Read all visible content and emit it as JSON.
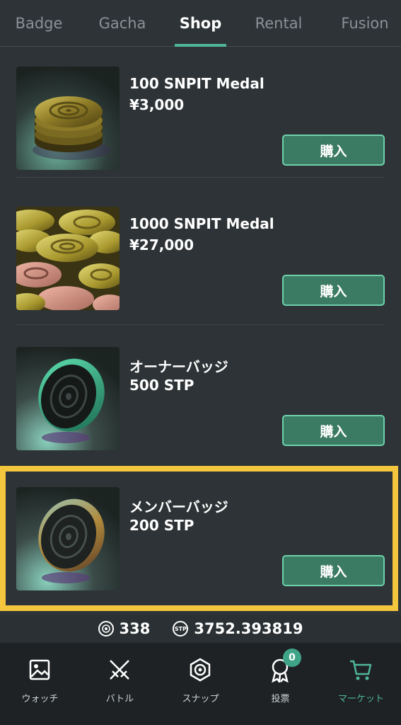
{
  "tabs": [
    {
      "label": "Badge",
      "active": false
    },
    {
      "label": "Gacha",
      "active": false
    },
    {
      "label": "Shop",
      "active": true
    },
    {
      "label": "Rental",
      "active": false
    },
    {
      "label": "Fusion",
      "active": false
    }
  ],
  "items": [
    {
      "name": "100 SNPIT Medal",
      "price": "¥3,000",
      "buy_label": "購入",
      "image": "medal-stack-image"
    },
    {
      "name": "1000 SNPIT Medal",
      "price": "¥27,000",
      "buy_label": "購入",
      "image": "medal-pile-image"
    },
    {
      "name": "オーナーバッジ",
      "price": "500 STP",
      "buy_label": "購入",
      "image": "owner-badge-image"
    },
    {
      "name": "メンバーバッジ",
      "price": "200 STP",
      "buy_label": "購入",
      "image": "member-badge-image",
      "highlighted": true
    }
  ],
  "balance": {
    "medal_count": "338",
    "stp_icon_label": "STP",
    "stp_amount": "3752.393819"
  },
  "nav": [
    {
      "label": "ウォッチ",
      "icon": "image-icon"
    },
    {
      "label": "バトル",
      "icon": "swords-icon"
    },
    {
      "label": "スナップ",
      "icon": "camera-lens-icon"
    },
    {
      "label": "投票",
      "icon": "ribbon-icon",
      "badge": "0"
    },
    {
      "label": "マーケット",
      "icon": "cart-icon",
      "active": true
    }
  ],
  "colors": {
    "background": "#2d3336",
    "accent": "#4fb699",
    "button": "#3b7a63",
    "highlight": "#f3c63d"
  }
}
